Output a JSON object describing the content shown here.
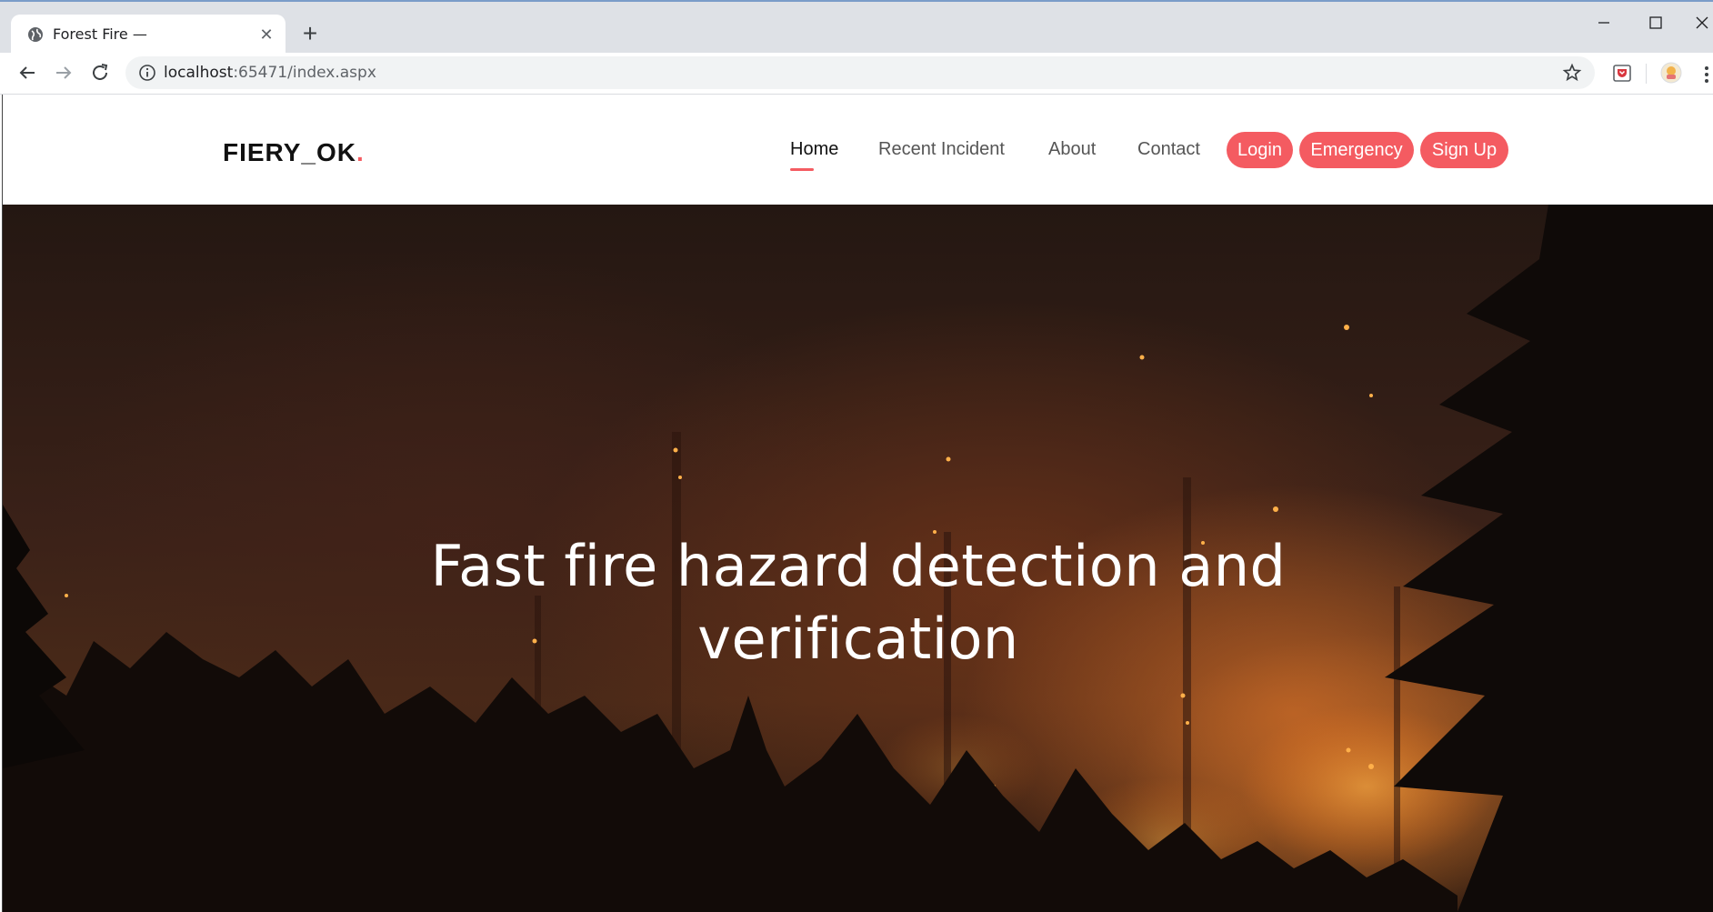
{
  "browser": {
    "tab_title": "Forest Fire —",
    "url_host": "localhost",
    "url_rest": ":65471/index.aspx"
  },
  "site": {
    "logo_text": "FIERY_OK",
    "logo_dot": ".",
    "nav": {
      "home": "Home",
      "recent": "Recent Incident",
      "about": "About",
      "contact": "Contact"
    },
    "buttons": {
      "login": "Login",
      "emergency": "Emergency",
      "signup": "Sign Up"
    },
    "hero": {
      "title_line1": "Fast fire hazard detection and",
      "title_line2": "verification"
    },
    "colors": {
      "accent": "#f45b61"
    }
  }
}
